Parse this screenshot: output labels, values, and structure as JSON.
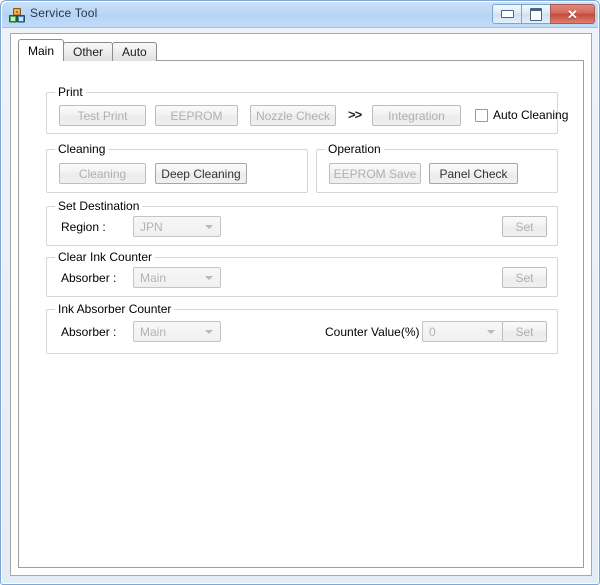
{
  "window": {
    "title": "Service Tool",
    "icon": "blocks-icon",
    "controls": {
      "minimize": "minimize-icon",
      "maximize": "maximize-icon",
      "close": "✕"
    }
  },
  "tabs": [
    {
      "label": "Main",
      "active": true
    },
    {
      "label": "Other",
      "active": false
    },
    {
      "label": "Auto",
      "active": false
    }
  ],
  "groups": {
    "print": {
      "title": "Print",
      "buttons": [
        {
          "label": "Test Print",
          "enabled": false
        },
        {
          "label": "EEPROM",
          "enabled": false
        },
        {
          "label": "Nozzle Check",
          "enabled": false
        },
        {
          "label": "Integration",
          "enabled": false
        }
      ],
      "separator": ">>",
      "checkbox": {
        "label": "Auto Cleaning",
        "checked": false
      }
    },
    "cleaning": {
      "title": "Cleaning",
      "buttons": [
        {
          "label": "Cleaning",
          "enabled": false
        },
        {
          "label": "Deep Cleaning",
          "enabled": true
        }
      ]
    },
    "operation": {
      "title": "Operation",
      "buttons": [
        {
          "label": "EEPROM Save",
          "enabled": false
        },
        {
          "label": "Panel Check",
          "enabled": true
        }
      ]
    },
    "set_destination": {
      "title": "Set Destination",
      "field_label": "Region :",
      "combo_value": "JPN",
      "set_label": "Set"
    },
    "clear_ink_counter": {
      "title": "Clear Ink Counter",
      "field_label": "Absorber :",
      "combo_value": "Main",
      "set_label": "Set"
    },
    "ink_absorber_counter": {
      "title": "Ink Absorber Counter",
      "field_label": "Absorber :",
      "combo_value": "Main",
      "counter_label": "Counter Value(%) :",
      "counter_value": "0",
      "set_label": "Set"
    }
  },
  "colors": {
    "titlebar": "#b9d6f5",
    "close_button": "#c44a3c",
    "window_border": "#7ea7d4",
    "group_border": "#d6d6d6",
    "disabled_text": "#b0b0b0",
    "enabled_text": "#333333"
  }
}
